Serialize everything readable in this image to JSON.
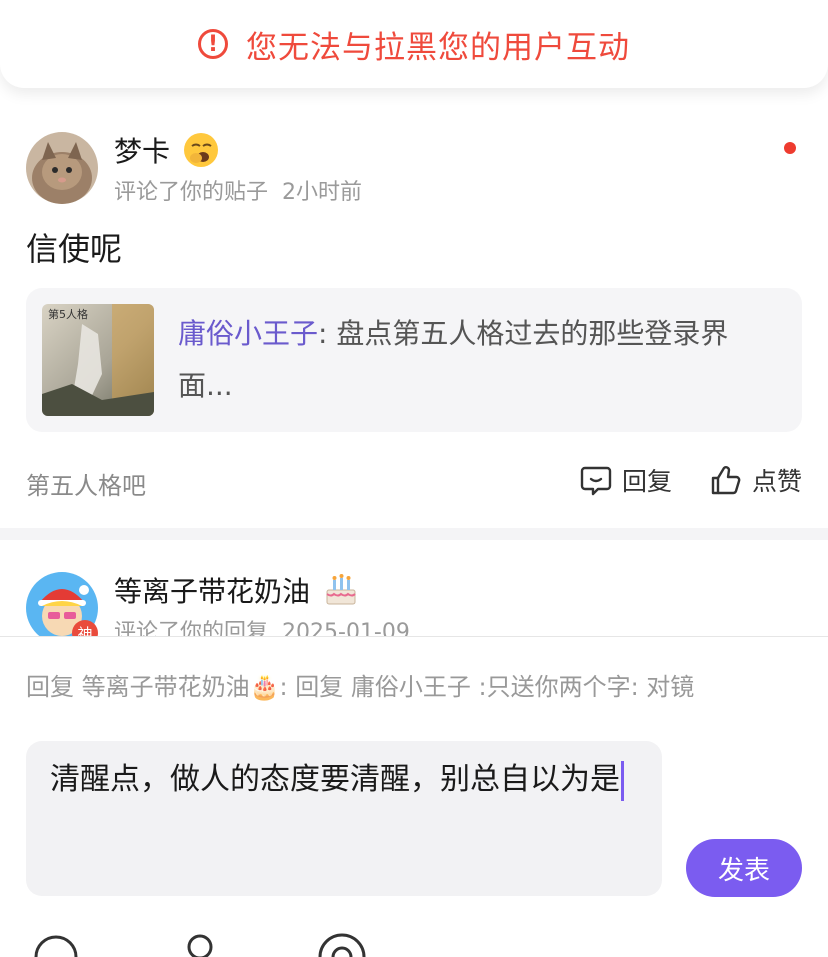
{
  "toast": {
    "text": "您无法与拉黑您的用户互动",
    "icon": "alert-circle-icon",
    "color": "#ef4a3c"
  },
  "notifications": [
    {
      "user_name": "梦卡",
      "user_emoji": "yawning-face",
      "action": "评论了你的贴子",
      "time": "2小时前",
      "unread": true,
      "comment": "信使呢",
      "quoted_post": {
        "author": "庸俗小王子",
        "separator": ": ",
        "text": "盘点第五人格过去的那些登录界面..."
      },
      "forum": "第五人格吧",
      "reply_label": "回复",
      "like_label": "点赞"
    },
    {
      "user_name": "等离子带花奶油",
      "user_emoji": "birthday-cake",
      "action": "评论了你的回复",
      "time": "2025-01-09",
      "badge": "神"
    }
  ],
  "reply_panel": {
    "target_text": "回复 等离子带花奶油🎂:  回复  庸俗小王子 :只送你两个字: 对镜",
    "input_value": "清醒点，做人的态度要清醒，别总自以为是",
    "send_label": "发表",
    "accent_color": "#7b5cf0"
  }
}
